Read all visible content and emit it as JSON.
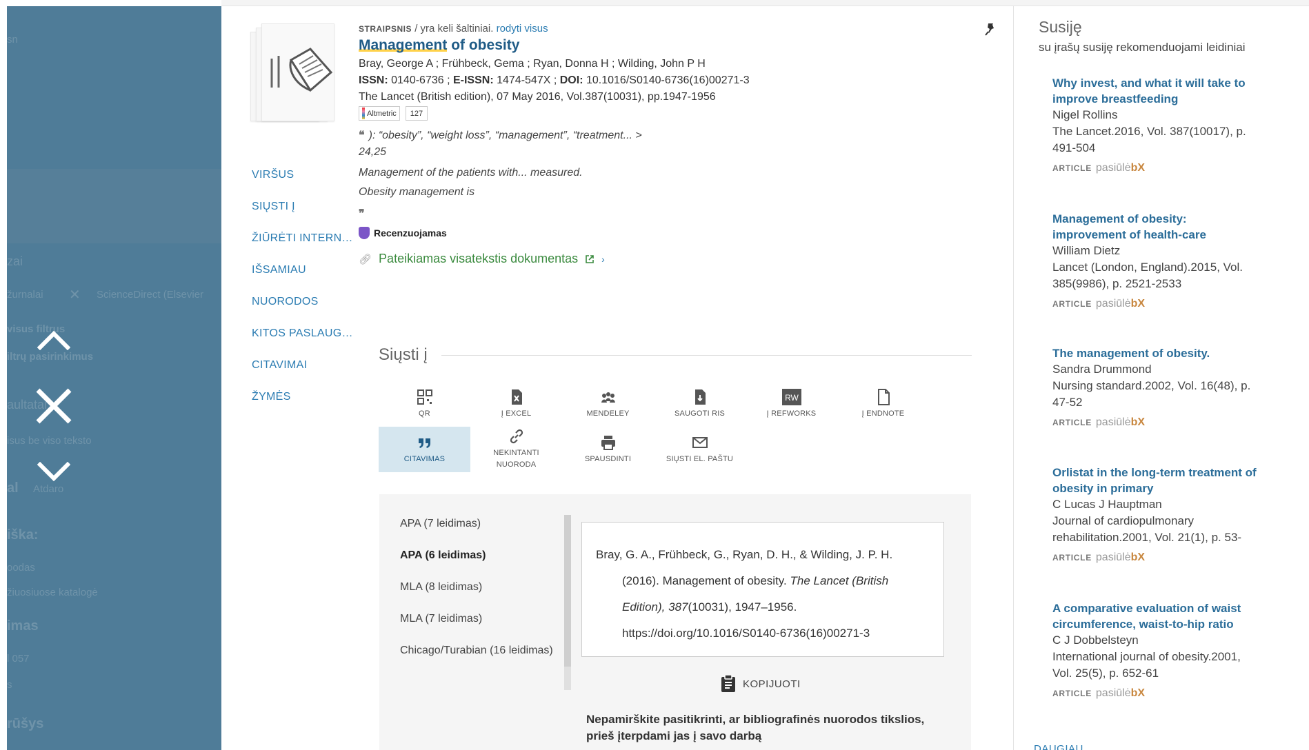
{
  "overlay": {
    "ghost_texts": [
      "sn",
      "zai",
      "žurnalai",
      "ScienceDirect (Elsevier",
      "visus filtrus",
      "iltrų pasirinkimus",
      "aultatai",
      "isus be viso teksto",
      "al",
      "Atdaro",
      "iška:",
      "oodas",
      "žiuosiuose katalogė",
      "imas",
      "l 057",
      "s",
      "rūšys"
    ],
    "controls": {
      "up": "chevron-up-icon",
      "close": "close-icon",
      "down": "chevron-down-icon"
    }
  },
  "record": {
    "type": "STRAIPSNIS",
    "sources_text": "/ yra keli šaltiniai.",
    "show_all": "rodyti visus",
    "title_hl": "Management",
    "title_rest": "of obesity",
    "authors": "Bray, George A ; Frühbeck, Gema ; Ryan, Donna H ; Wilding, John P H",
    "issn_label": "ISSN:",
    "issn": "0140-6736 ;",
    "eissn_label": "E-ISSN:",
    "eissn": "1474-547X ;",
    "doi_label": "DOI:",
    "doi": "10.1016/S0140-6736(16)00271-3",
    "source": "The Lancet (British edition), 07 May 2016, Vol.387(10031), pp.1947-1956",
    "altmetric": "Altmetric",
    "altmetric_count": "127",
    "snippet_keywords": "): “obesity”, “weight loss”, “management”, “treatment... >",
    "snippet_pages": "24,25",
    "snippet_abstract": "Management of the patients with... measured.",
    "snippet_body": "Obesity management is",
    "peer_reviewed": "Recenzuojamas",
    "fulltext": "Pateikiamas visatekstis dokumentas"
  },
  "side_nav": [
    "VIRŠUS",
    "SIŲSTI Į",
    "ŽIŪRĖTI INTERNETE",
    "IŠSAMIAU",
    "NUORODOS",
    "KITOS PASLAUGOS",
    "CITAVIMAI",
    "ŽYMĖS"
  ],
  "send": {
    "heading": "Siųsti į",
    "actions": [
      {
        "label": "QR",
        "icon": "qr-icon"
      },
      {
        "label": "Į EXCEL",
        "icon": "excel-icon"
      },
      {
        "label": "MENDELEY",
        "icon": "mendeley-icon"
      },
      {
        "label": "SAUGOTI RIS",
        "icon": "ris-file-icon"
      },
      {
        "label": "Į REFWORKS",
        "icon": "refworks-icon"
      },
      {
        "label": "Į ENDNOTE",
        "icon": "endnote-icon"
      },
      {
        "label": "CITAVIMAS",
        "icon": "quote-icon"
      },
      {
        "label": "NEKINTANTI NUORODA",
        "icon": "link-icon"
      },
      {
        "label": "SPAUSDINTI",
        "icon": "print-icon"
      },
      {
        "label": "SIŲSTI EL. PAŠTU",
        "icon": "email-icon"
      }
    ]
  },
  "citation": {
    "styles": [
      "APA (7 leidimas)",
      "APA (6 leidimas)",
      "MLA (8 leidimas)",
      "MLA (7 leidimas)",
      "Chicago/Turabian (16 leidimas)"
    ],
    "selected_style": "APA (6 leidimas)",
    "text_a": "Bray, G. A., Frühbeck, G., Ryan, D. H., & Wilding, J. P. H. (2016). Management of obesity.",
    "text_journal": "The Lancet (British Edition),",
    "text_vol": "387",
    "text_b": "(10031), 1947–1956. https://doi.org/10.1016/S0140-6736(16)00271-3",
    "copy": "KOPIJUOTI",
    "warning": "Nepamirškite pasitikrinti, ar bibliografinės nuorodos tikslios, prieš įterpdami jas į savo darbą"
  },
  "related": {
    "heading": "Susiję",
    "subheading": "su įrašų susiję rekomenduojami leidiniai",
    "badge": "ARTICLE",
    "provider": "pasiūlė",
    "provider_mark": "bX",
    "items": [
      {
        "title": "Why invest, and what it will take to improve breastfeeding",
        "author": "Nigel Rollins",
        "source": "The Lancet.2016, Vol. 387(10017), p. 491-504"
      },
      {
        "title": "Management of obesity: improvement of health-care",
        "author": "William Dietz",
        "source": "Lancet (London, England).2015, Vol. 385(9986), p. 2521-2533"
      },
      {
        "title": "The management of obesity.",
        "author": "Sandra Drummond",
        "source": "Nursing standard.2002, Vol. 16(48), p. 47-52"
      },
      {
        "title": "Orlistat in the long-term treatment of obesity in primary",
        "author": "C Lucas J Hauptman",
        "source": "Journal of cardiopulmonary rehabilitation.2001, Vol. 21(1), p. 53-"
      },
      {
        "title": "A comparative evaluation of waist circumference, waist-to-hip ratio",
        "author": "C J Dobbelsteyn",
        "source": "International journal of obesity.2001, Vol. 25(5), p. 652-61"
      }
    ],
    "more": "DAUGIAU"
  }
}
